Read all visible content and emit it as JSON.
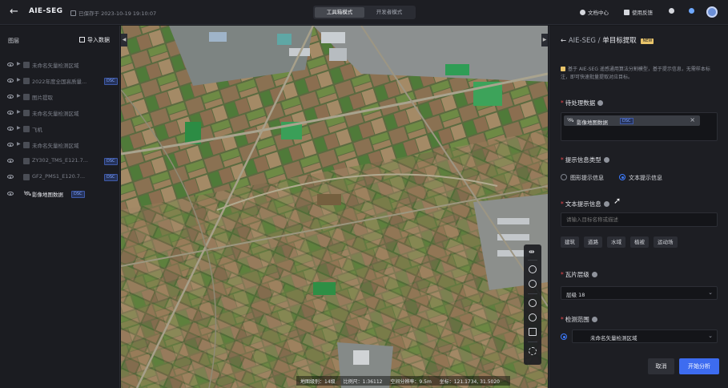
{
  "topbar": {
    "app_title": "AIE-SEG",
    "save_status": "已保存于 2023-10-19 19:10:07",
    "modes": [
      "工具箱模式",
      "开发者模式"
    ],
    "active_mode": "工具箱模式",
    "right_items": [
      "文档中心",
      "使用反馈"
    ]
  },
  "left_panel": {
    "title": "图层",
    "import_label": "导入数据",
    "layers": [
      {
        "name": "未命名矢量检测区域",
        "tag": "",
        "active": false
      },
      {
        "name": "2022年度全国高质量...",
        "tag": "DSC",
        "active": false
      },
      {
        "name": "图片提取",
        "tag": "",
        "active": false
      },
      {
        "name": "未命名矢量检测区域",
        "tag": "",
        "active": false
      },
      {
        "name": "飞机",
        "tag": "",
        "active": false
      },
      {
        "name": "未命名矢量检测区域",
        "tag": "",
        "active": false
      },
      {
        "name": "ZY302_TMS_E121.7...",
        "tag": "DSC",
        "active": false
      },
      {
        "name": "GF2_PMS1_E120.7...",
        "tag": "DSC",
        "active": false
      },
      {
        "name": "影像地图数据",
        "tag": "DSC",
        "active": true
      }
    ]
  },
  "map": {
    "status": [
      "地图级别：14级",
      "比例尺：1:36112",
      "空间分辨率：9.5m",
      "坐标：121.1734, 31.5020"
    ]
  },
  "right_panel": {
    "crumb": "AIE-SEG",
    "title": "单目标提取",
    "new_badge": "NEW",
    "notice": "基于 AIE-SEG 遥感通用算法分割模型，基于提示信息，无需样本标注，即可快速批量提取对应目标。",
    "data_label": "待处理数据",
    "data_chip": {
      "name": "影像地图数据",
      "tag": "DSC"
    },
    "prompt_type_label": "提示信息类型",
    "prompt_types": [
      "图形提示信息",
      "文本提示信息"
    ],
    "prompt_type_selected": "文本提示信息",
    "text_prompt_label": "文本提示信息",
    "text_prompt_placeholder": "请输入目标名称或描述",
    "quick_tags": [
      "建筑",
      "道路",
      "水域",
      "植被",
      "运动场"
    ],
    "tile_level_label": "瓦片层级",
    "tile_level_value": "层级 18",
    "range_label": "检测范围",
    "range_value": "未命名矢量检测区域",
    "cancel_label": "取消",
    "run_label": "开始分析"
  },
  "colors": {
    "accent": "#3d6cf0",
    "badge": "#e9c46a",
    "tag": "#7da3ff"
  }
}
